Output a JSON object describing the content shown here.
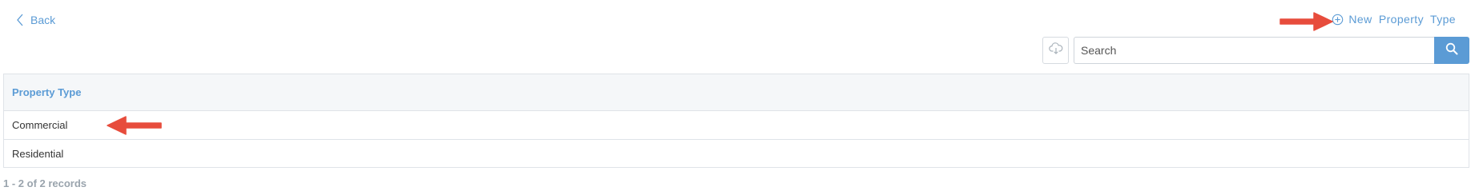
{
  "nav": {
    "back_label": "Back",
    "back_icon": "chevron-left-icon"
  },
  "actions": {
    "new_label": "New Property Type",
    "new_icon": "plus-circle-icon"
  },
  "toolbar": {
    "export_icon": "cloud-download-icon",
    "search_placeholder": "Search",
    "search_value": "",
    "search_icon": "search-icon"
  },
  "table": {
    "column_header": "Property Type",
    "rows": [
      {
        "label": "Commercial"
      },
      {
        "label": "Residential"
      }
    ]
  },
  "footer": {
    "records_text": "1 - 2 of 2 records"
  },
  "annotations": {
    "arrow_color": "#e74c3c"
  },
  "colors": {
    "accent": "#5b9bd5",
    "border": "#dfe3e8",
    "header_bg": "#f5f7f9",
    "muted_text": "#9aa4ad"
  }
}
